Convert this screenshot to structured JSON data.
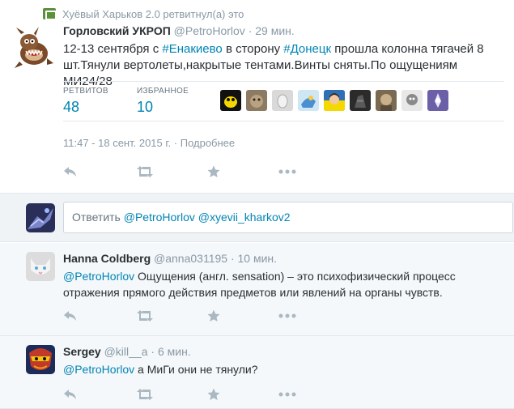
{
  "retweet_context": "Хуёвый Харьков 2.0 ретвитнул(а) это",
  "main_tweet": {
    "fullname": "Горловский УКРОП",
    "username": "@PetroHorlov",
    "separator": "·",
    "time_ago": "29 мин.",
    "text_1": "12-13 сентября с ",
    "hashtag_1": "#Енакиево",
    "text_2": " в сторону ",
    "hashtag_2": "#Донецк",
    "text_3": " прошла колонна тягачей 8 шт.Тянули вертолеты,накрытые тентами.Винты сняты.По ощущениям МИ24/28",
    "retweets_label": "РЕТВИТОВ",
    "retweets_count": "48",
    "favorites_label": "ИЗБРАННОЕ",
    "favorites_count": "10",
    "timestamp": "11:47 - 18 сент. 2015 г.",
    "details_link": "Подробнее",
    "favoriter_avatars": [
      "avatar-1",
      "avatar-2",
      "avatar-3",
      "avatar-4",
      "avatar-5",
      "avatar-6",
      "avatar-7",
      "avatar-8",
      "avatar-9"
    ]
  },
  "reply_box": {
    "placeholder_prefix": "Ответить ",
    "mention_1": "@PetroHorlov",
    "mention_2": "@xyevii_kharkov2"
  },
  "replies": [
    {
      "fullname": "Hanna Coldberg",
      "username": "@anna031195",
      "separator": "·",
      "time_ago": "10 мин.",
      "mention": "@PetroHorlov",
      "text": " Ощущения (англ. sensation) – это психофизический процесс отражения прямого действия предметов или явлений на органы чувств."
    },
    {
      "fullname": "Sergey",
      "username": "@kill__a",
      "separator": "·",
      "time_ago": "6 мин.",
      "mention": "@PetroHorlov",
      "text": " а МиГи они не тянули?"
    }
  ],
  "icons": {
    "reply": "reply-icon",
    "retweet": "retweet-icon",
    "favorite": "star-icon",
    "more": "more-icon"
  },
  "colors": {
    "link": "#0084b4",
    "meta": "#8899a6",
    "icon": "#aab8c2",
    "reply_bg": "#f5f8fa",
    "retweet_green": "#5c913b"
  }
}
